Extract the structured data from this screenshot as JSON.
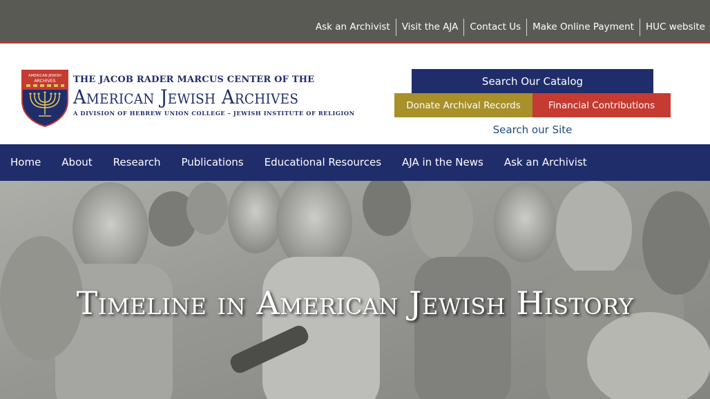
{
  "utility": {
    "links": [
      "Ask an Archivist",
      "Visit the AJA",
      "Contact Us",
      "Make Online Payment",
      "HUC website"
    ]
  },
  "logo": {
    "line1": "The Jacob Rader Marcus Center of the",
    "line2": "American Jewish Archives",
    "line3": "A DIVISION OF HEBREW UNION COLLEGE – JEWISH INSTITUTE OF RELIGION",
    "shield_top_text": "AMERICAN JEWISH ARCHIVES",
    "icon": "menorah-shield-icon"
  },
  "actions": {
    "catalog": "Search Our Catalog",
    "donate": "Donate Archival Records",
    "financial": "Financial Contributions",
    "search_site": "Search our Site"
  },
  "nav": {
    "items": [
      "Home",
      "About",
      "Research",
      "Publications",
      "Educational Resources",
      "AJA in the News",
      "Ask an Archivist"
    ]
  },
  "hero": {
    "title": "Timeline in American Jewish History"
  },
  "colors": {
    "utility_bar": "#5a5a55",
    "accent_red": "#b23a2e",
    "navy": "#1f2d6b",
    "gold": "#a8902a",
    "red_button": "#c53a31",
    "link_blue": "#1f4b7a"
  }
}
